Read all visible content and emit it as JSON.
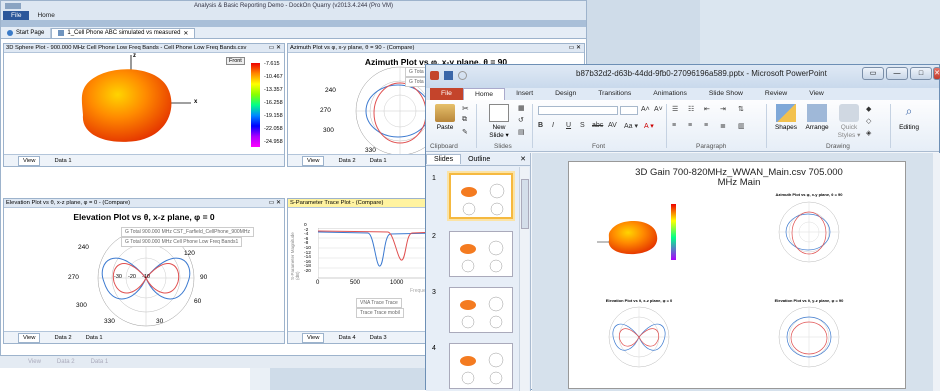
{
  "back_app": {
    "title": "Analysis & Basic Reporting Demo - DockOn Quarry (v2013.4.244 (Pro VM)",
    "file_tab": "File",
    "home_tab": "Home",
    "doc_tabs": [
      {
        "label": "Start Page"
      },
      {
        "label": "1_Cell Phone ABC simulated vs measured",
        "close": "✕"
      }
    ],
    "panels": {
      "sphere": {
        "header": "3D Sphere Plot - 900.000 MHz Cell Phone Low Freq Bands - Cell Phone Low Freq Bands.csv",
        "front": "Front",
        "axis_z": "z",
        "axis_x": "x",
        "colorbar": [
          "-7.615",
          "-10.467",
          "-13.357",
          "-16.258",
          "-19.158",
          "-22.058",
          "-24.958"
        ],
        "footer": [
          "View",
          "Data 1"
        ]
      },
      "azimuth": {
        "header": "Azimuth Plot vs φ, x-y plane, θ = 90 - (Compare)",
        "title": "Azimuth Plot vs φ, x-y plane, θ = 90",
        "leg1": "G Tota",
        "leg2": "G Tota",
        "ticks": [
          "240",
          "270",
          "300",
          "330"
        ],
        "footer": [
          "View",
          "Data 2",
          "Data 1"
        ]
      },
      "elevation": {
        "header": "Elevation Plot vs θ, x-z plane, φ = 0 - (Compare)",
        "title": "Elevation Plot vs θ, x-z plane, φ = 0",
        "leg1": "G Total 900.000 MHz CST_Farfield_CellPhone_900MHz",
        "leg2": "G Total 900.000 MHz Cell Phone Low Freq Bands1",
        "ticks": [
          "240",
          "270",
          "300",
          "330",
          "120",
          "90",
          "60",
          "30",
          "-30",
          "-20",
          "-10"
        ],
        "footer": [
          "View",
          "Data 2",
          "Data 1"
        ]
      },
      "sparam": {
        "header": "S-Parameter Trace Plot - (Compare)",
        "title": "VNA Tra",
        "xticks": [
          "0",
          "500",
          "1000"
        ],
        "yticks": [
          "0",
          "-2",
          "-4",
          "-6",
          "-8",
          "-10",
          "-12",
          "-14",
          "-16",
          "-18",
          "-20"
        ],
        "ylabel": "S-Parameter Magnitude (dB)",
        "xlabel": "Frequen",
        "leg1": "VNA Trace Trace",
        "leg2": "Trace Trace mobil",
        "footer": [
          "View",
          "Data 4",
          "Data 3"
        ]
      }
    },
    "extra_footer": [
      "View",
      "Data 2",
      "Data 1"
    ]
  },
  "ppt": {
    "title": "b87b32d2-d63b-44dd-9fb0-27096196a589.pptx - Microsoft PowerPoint",
    "window_buttons": [
      "▭",
      "—",
      "□",
      "✕"
    ],
    "tabs": [
      "File",
      "Home",
      "Insert",
      "Design",
      "Transitions",
      "Animations",
      "Slide Show",
      "Review",
      "View"
    ],
    "ribbon": {
      "paste": "Paste",
      "new_slide": "New",
      "new_slide2": "Slide ▾",
      "group_clipboard": "Clipboard",
      "group_slides": "Slides",
      "group_font": "Font",
      "group_paragraph": "Paragraph",
      "group_drawing": "Drawing",
      "font_btns": [
        "B",
        "I",
        "U",
        "S",
        "abc",
        "AV",
        "Aa ▾",
        "A ▾"
      ],
      "grow": "A˄",
      "shrink": "A˅",
      "shapes": "Shapes",
      "arrange": "Arrange",
      "quick": "Quick",
      "styles": "Styles ▾",
      "editing": "Editing"
    },
    "pane_tabs": [
      "Slides",
      "Outline"
    ],
    "pane_close": "✕",
    "slide_numbers": [
      "1",
      "2",
      "3",
      "4"
    ],
    "slide": {
      "title": "3D Gain 700-820MHz_WWAN_Main.csv 705.000 MHz Main",
      "az_label": "Azimuth Plot vs φ, x-y plane, θ = 90",
      "el1_label": "Elevation Plot vs θ, x-z plane, φ = 0",
      "el2_label": "Elevation Plot vs θ, y-z plane, φ = 90"
    }
  }
}
